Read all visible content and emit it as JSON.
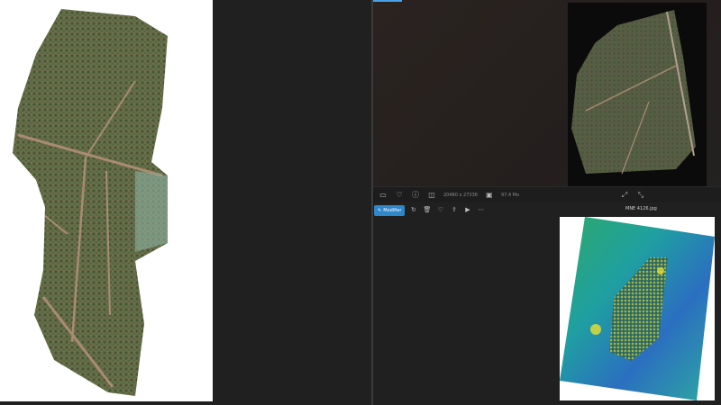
{
  "top_viewer": {
    "dimensions": "20480 x 27336",
    "size": "97.4 Mo"
  },
  "bottom_viewer": {
    "edit_label": "Modifier",
    "file_name": "MNE 4126.jpg"
  },
  "icons": {
    "statusbar": [
      "monitor-icon",
      "heart-icon",
      "info-icon",
      "image-size-icon",
      "disk-icon",
      "fit-screen-icon",
      "fullscreen-icon"
    ],
    "toolbar": [
      "edit-icon",
      "rotate-icon",
      "delete-icon",
      "heart-icon",
      "share-icon",
      "slideshow-icon",
      "more-icon"
    ]
  },
  "colors": {
    "accent": "#2f86c9",
    "background": "#1f1f1f"
  }
}
